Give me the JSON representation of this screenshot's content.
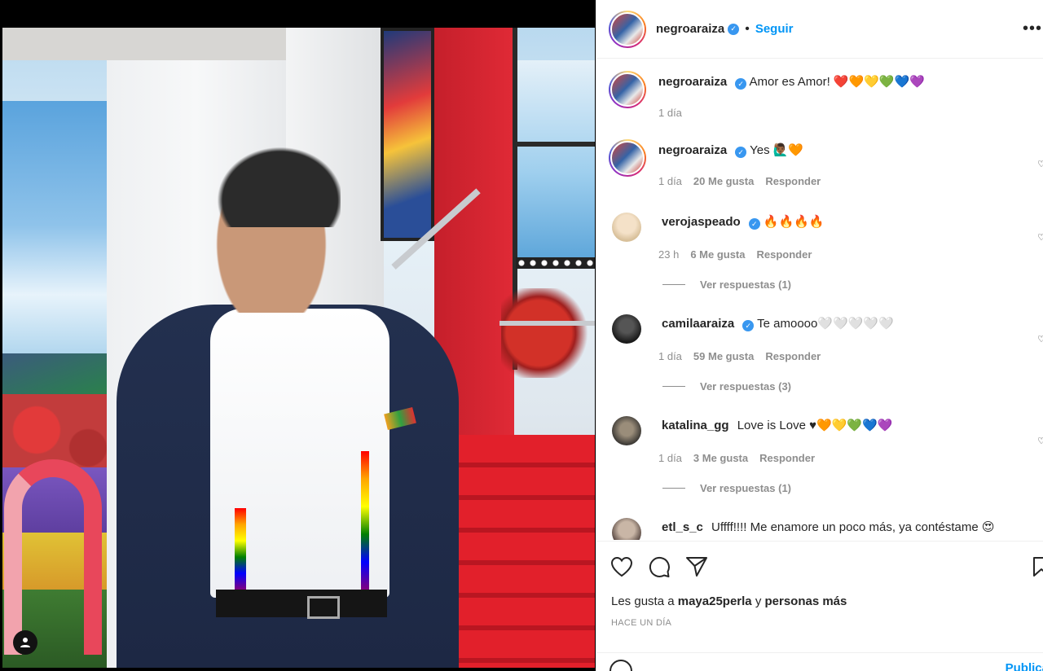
{
  "post": {
    "username": "negroaraiza",
    "follow_label": "Seguir",
    "more_icon": "more-options-icon",
    "separator": "•"
  },
  "comments": [
    {
      "user": "negroaraiza",
      "verified": true,
      "text": "Amor es Amor! ❤️🧡💛💚💙💜",
      "time": "1 día",
      "likes": "",
      "reply": ""
    },
    {
      "user": "negroaraiza",
      "verified": true,
      "text": "Yes 🙋🏾‍♂️🧡",
      "time": "1 día",
      "likes": "20 Me gusta",
      "reply": "Responder"
    },
    {
      "user": "verojaspeado",
      "verified": true,
      "text": "🔥🔥🔥🔥",
      "time": "23 h",
      "likes": "6 Me gusta",
      "reply": "Responder",
      "replies": "Ver respuestas (1)"
    },
    {
      "user": "camilaaraiza",
      "verified": true,
      "text": "Te amoooo🤍🤍🤍🤍🤍",
      "time": "1 día",
      "likes": "59 Me gusta",
      "reply": "Responder",
      "replies": "Ver respuestas (3)"
    },
    {
      "user": "katalina_gg",
      "verified": false,
      "text": "Love is Love ♥🧡💛💚💙💜",
      "time": "1 día",
      "likes": "3 Me gusta",
      "reply": "Responder",
      "replies": "Ver respuestas (1)"
    },
    {
      "user": "etl_s_c",
      "verified": false,
      "text": "Uffff!!!! Me enamore un poco más, ya contéstame 😍",
      "time": "",
      "likes": "",
      "reply": ""
    }
  ],
  "likes": {
    "prefix": "Les gusta a",
    "user": "maya25perla",
    "connector": "y",
    "rest": "personas más"
  },
  "date": "HACE UN DÍA",
  "compose": {
    "placeholder": "",
    "post_label": "Publica"
  },
  "colors": {
    "link_blue": "#0095f6",
    "verified_blue": "#3897f0",
    "muted": "#8e8e8e"
  }
}
